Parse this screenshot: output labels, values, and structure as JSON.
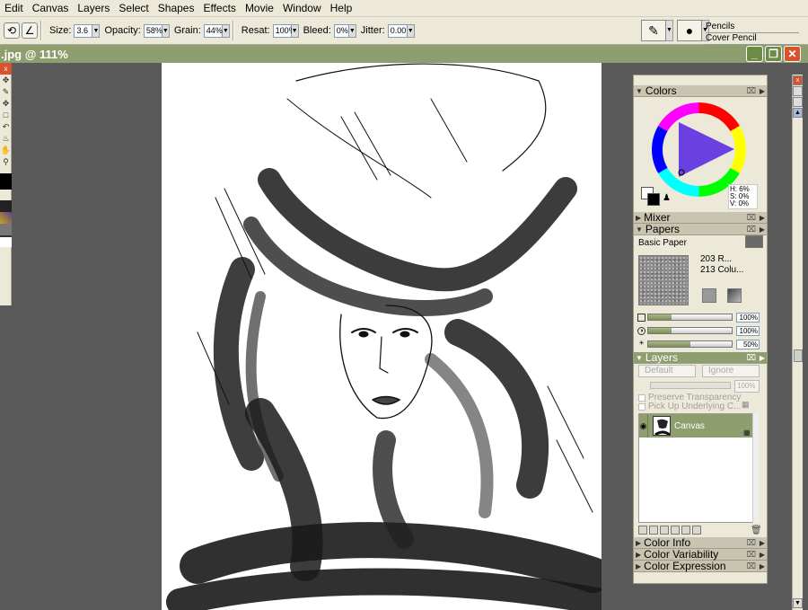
{
  "menu": [
    "Edit",
    "Canvas",
    "Layers",
    "Select",
    "Shapes",
    "Effects",
    "Movie",
    "Window",
    "Help"
  ],
  "propbar": {
    "size_label": "Size:",
    "size_value": "3.6",
    "opacity_label": "Opacity:",
    "opacity_value": "58%",
    "grain_label": "Grain:",
    "grain_value": "44%",
    "resat_label": "Resat:",
    "resat_value": "100%",
    "bleed_label": "Bleed:",
    "bleed_value": "0%",
    "jitter_label": "Jitter:",
    "jitter_value": "0.00",
    "brush_category": "Pencils",
    "brush_variant": "Cover Pencil"
  },
  "document": {
    "title": ".jpg @ 111%"
  },
  "panels": {
    "colors": {
      "title": "Colors",
      "h": "H: 6%",
      "s": "S: 0%",
      "v": "V: 0%"
    },
    "mixer": {
      "title": "Mixer"
    },
    "papers": {
      "title": "Papers",
      "paper_name": "Basic Paper",
      "line1": "203 R...",
      "line2": "213 Colu...",
      "scale": "100%",
      "contrast": "100%",
      "brightness": "50%"
    },
    "layers": {
      "title": "Layers",
      "composite_method": "Default",
      "depth": "Ignore",
      "opacity": "100%",
      "preserve_transparency": "Preserve Transparency",
      "pick_up_underlying": "Pick Up Underlying C...",
      "layer_name": "Canvas"
    },
    "color_info": {
      "title": "Color Info"
    },
    "color_variability": {
      "title": "Color Variability"
    },
    "color_expression": {
      "title": "Color Expression"
    }
  }
}
